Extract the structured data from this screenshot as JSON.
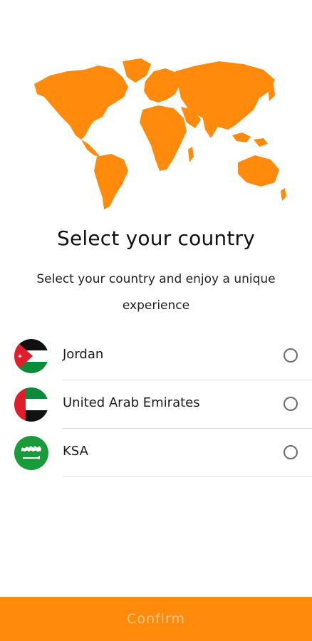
{
  "brand": {
    "accent": "#ff8a0b",
    "map_color": "#ff8a0b"
  },
  "header": {
    "title": "Select your country",
    "subtitle": "Select your country and enjoy a unique experience"
  },
  "countries": [
    {
      "name": "Jordan",
      "flag": "jordan-flag-icon",
      "selected": false
    },
    {
      "name": "United Arab Emirates",
      "flag": "uae-flag-icon",
      "selected": false
    },
    {
      "name": "KSA",
      "flag": "ksa-flag-icon",
      "selected": false
    }
  ],
  "footer": {
    "confirm_label": "Confirm",
    "enabled": false
  }
}
